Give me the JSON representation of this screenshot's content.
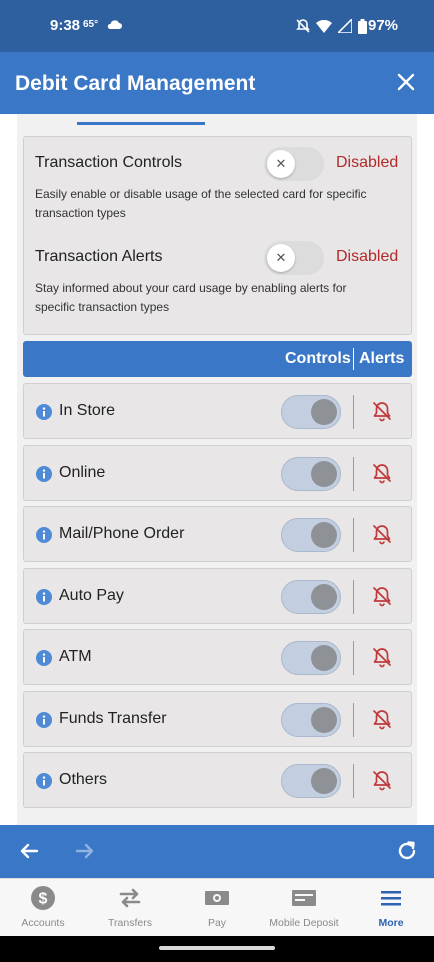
{
  "status_bar": {
    "time": "9:38",
    "temperature": "65°",
    "battery": "97%"
  },
  "header": {
    "title": "Debit Card Management"
  },
  "transaction_controls": {
    "title": "Transaction Controls",
    "description": "Easily enable or disable usage of the selected card for specific transaction types",
    "status": "Disabled",
    "enabled": false
  },
  "transaction_alerts": {
    "title": "Transaction Alerts",
    "description": "Stay informed about your card usage by enabling alerts for specific transaction types",
    "status": "Disabled",
    "enabled": false
  },
  "table": {
    "controls_label": "Controls",
    "alerts_label": "Alerts"
  },
  "rows": [
    {
      "label": "In Store"
    },
    {
      "label": "Online"
    },
    {
      "label": "Mail/Phone Order"
    },
    {
      "label": "Auto Pay"
    },
    {
      "label": "ATM"
    },
    {
      "label": "Funds Transfer"
    },
    {
      "label": "Others"
    }
  ],
  "bottom_nav": {
    "accounts": "Accounts",
    "transfers": "Transfers",
    "pay": "Pay",
    "mobile_deposit": "Mobile Deposit",
    "more": "More"
  },
  "colors": {
    "brand_blue": "#3a77c7",
    "disabled_red": "#b22a2a",
    "bell_red": "#c0393b",
    "active_nav": "#2e63b3"
  },
  "icons": {
    "status": [
      "cloud-icon",
      "mute-icon",
      "wifi-icon",
      "signal-icon",
      "battery-icon"
    ],
    "row": [
      "info-icon",
      "bell-off-icon"
    ],
    "browser": [
      "back-arrow-icon",
      "forward-arrow-icon",
      "refresh-icon"
    ],
    "nav": [
      "dollar-icon",
      "transfer-icon",
      "pay-icon",
      "mobile-deposit-icon",
      "menu-icon"
    ]
  }
}
